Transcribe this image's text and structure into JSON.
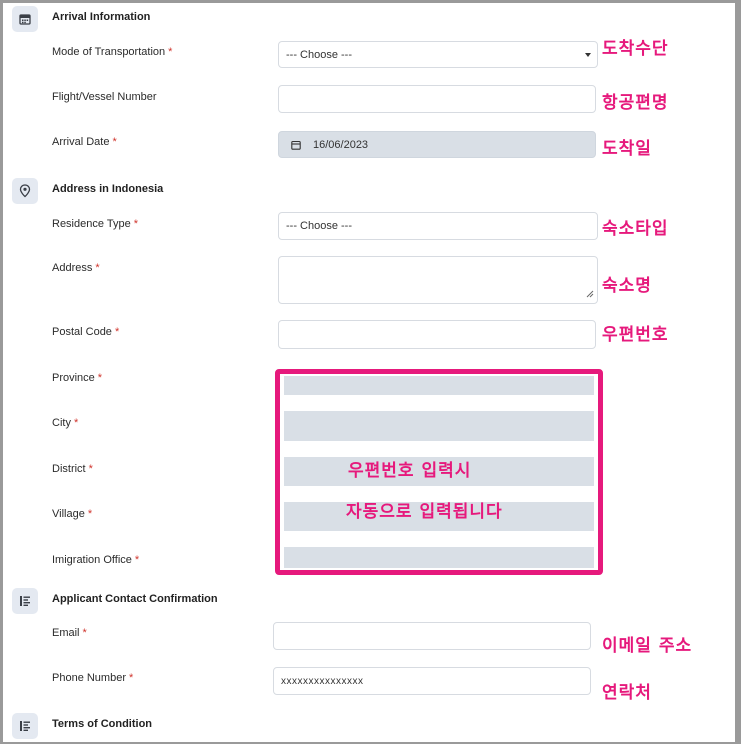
{
  "sections": {
    "arrival": "Arrival Information",
    "address": "Address in Indonesia",
    "contact": "Applicant Contact Confirmation",
    "terms": "Terms of Condition"
  },
  "fields": {
    "mode_of_transportation": {
      "label": "Mode of Transportation",
      "value": "--- Choose ---"
    },
    "flight_vessel_number": {
      "label": "Flight/Vessel Number",
      "value": ""
    },
    "arrival_date": {
      "label": "Arrival Date",
      "value": "16/06/2023"
    },
    "residence_type": {
      "label": "Residence Type",
      "value": "--- Choose ---"
    },
    "address": {
      "label": "Address",
      "value": ""
    },
    "postal_code": {
      "label": "Postal Code",
      "value": ""
    },
    "province": {
      "label": "Province"
    },
    "city": {
      "label": "City"
    },
    "district": {
      "label": "District"
    },
    "village": {
      "label": "Village"
    },
    "immigration_office": {
      "label": "Imigration Office"
    },
    "email": {
      "label": "Email",
      "value": ""
    },
    "phone_number": {
      "label": "Phone Number",
      "value": "xxxxxxxxxxxxxxx"
    }
  },
  "required_mark": "*",
  "annotations": {
    "transport": "도착수단",
    "flight": "항공편명",
    "arrival_date": "도착일",
    "residence": "숙소타입",
    "address": "숙소명",
    "postal": "우편번호",
    "auto_line1": "우편번호 입력시",
    "auto_line2": "자동으로 입력됩니다",
    "email": "이메일 주소",
    "phone": "연락처"
  },
  "colors": {
    "annotation": "#e6197c",
    "required": "#d0342c",
    "disabled_field": "#d9dfe6"
  },
  "icons": [
    "calendar-icon",
    "location-pin-icon",
    "list-icon",
    "list-icon",
    "calendar-icon"
  ]
}
